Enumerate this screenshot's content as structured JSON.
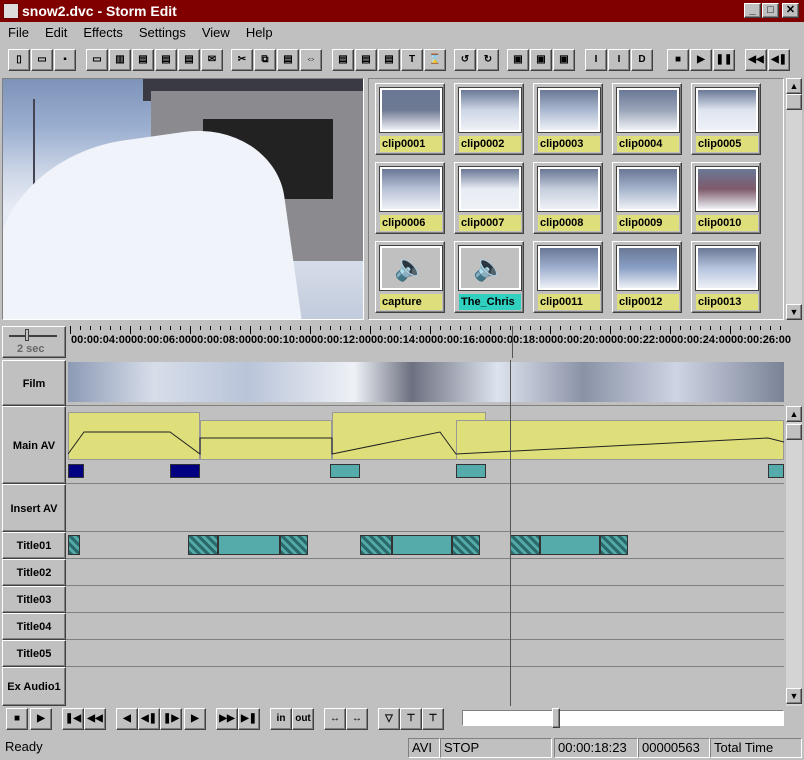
{
  "window": {
    "title": "snow2.dvc - Storm Edit",
    "controls": [
      "_",
      "□",
      "✕"
    ]
  },
  "menu": [
    "File",
    "Edit",
    "Effects",
    "Settings",
    "View",
    "Help"
  ],
  "clips": [
    {
      "label": "clip0001",
      "thumb": "#6f7a92"
    },
    {
      "label": "clip0002",
      "thumb": "#cdd6e6"
    },
    {
      "label": "clip0003",
      "thumb": "#aab8d0"
    },
    {
      "label": "clip0004",
      "thumb": "#9aa4b8"
    },
    {
      "label": "clip0005",
      "thumb": "#dfe5f0"
    },
    {
      "label": "clip0006",
      "thumb": "#b8c2d6"
    },
    {
      "label": "clip0007",
      "thumb": "#e8ecf3"
    },
    {
      "label": "clip0008",
      "thumb": "#c6cedd"
    },
    {
      "label": "clip0009",
      "thumb": "#a6b4cc"
    },
    {
      "label": "clip0010",
      "thumb": "#7e5a6a"
    },
    {
      "label": "capture",
      "audio": true
    },
    {
      "label": "The_Chris",
      "audio": true,
      "selected": true
    },
    {
      "label": "clip0011",
      "thumb": "#9fb0cf"
    },
    {
      "label": "clip0012",
      "thumb": "#8aa0c6"
    },
    {
      "label": "clip0013",
      "thumb": "#b5c3dd"
    }
  ],
  "zoom": "2 sec",
  "ruler": [
    "00:00:04:00",
    "00:00:06:00",
    "00:00:08:00",
    "00:00:10:00",
    "00:00:12:00",
    "00:00:14:00",
    "00:00:16:00",
    "00:00:18:00",
    "00:00:20:00",
    "00:00:22:00",
    "00:00:24:00",
    "00:00:26:00"
  ],
  "tracks": [
    "Film",
    "Main AV",
    "Insert AV",
    "Title01",
    "Title02",
    "Title03",
    "Title04",
    "Title05",
    "Ex Audio1"
  ],
  "transport": {
    "in": "in",
    "out": "out"
  },
  "status": {
    "ready": "Ready",
    "format": "AVI",
    "state": "STOP",
    "timecode": "00:00:18:23",
    "frame": "00000563",
    "mode": "Total Time"
  }
}
